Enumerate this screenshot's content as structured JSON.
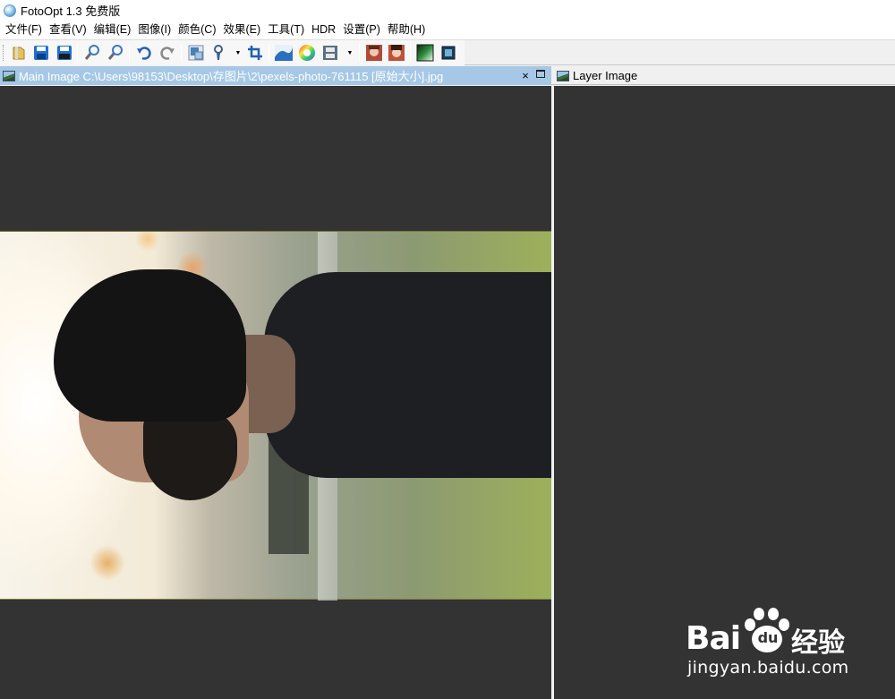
{
  "window": {
    "title": "FotoOpt 1.3 免费版"
  },
  "menu": [
    {
      "label": "文件(F)"
    },
    {
      "label": "查看(V)"
    },
    {
      "label": "编辑(E)"
    },
    {
      "label": "图像(I)"
    },
    {
      "label": "颜色(C)"
    },
    {
      "label": "效果(E)"
    },
    {
      "label": "工具(T)"
    },
    {
      "label": "HDR"
    },
    {
      "label": "设置(P)"
    },
    {
      "label": "帮助(H)"
    }
  ],
  "toolbar": {
    "buttons": [
      {
        "name": "open-file",
        "icon": "folder-icon",
        "color": "#e8c060"
      },
      {
        "name": "save",
        "icon": "floppy-icon",
        "color": "#1f6fd0"
      },
      {
        "name": "save-as",
        "icon": "floppy-stack-icon",
        "color": "#1f6fd0"
      },
      {
        "name": "zoom-in",
        "icon": "zoom-in-icon",
        "color": "#3a78c4"
      },
      {
        "name": "zoom-out",
        "icon": "zoom-out-icon",
        "color": "#3a78c4"
      },
      {
        "name": "undo",
        "icon": "undo-icon",
        "color": "#2a5fb5"
      },
      {
        "name": "redo",
        "icon": "redo-icon",
        "color": "#8a8a8a"
      },
      {
        "name": "resize",
        "icon": "resize-icon",
        "color": "#4a7fb8"
      },
      {
        "name": "brush",
        "icon": "brush-icon",
        "color": "#3d5f8c"
      },
      {
        "name": "crop",
        "icon": "crop-icon",
        "color": "#1f5fb0"
      },
      {
        "name": "levels",
        "icon": "levels-icon",
        "color": "#2b6fc0"
      },
      {
        "name": "color-wheel",
        "icon": "color-wheel-icon",
        "color": "#e04090"
      },
      {
        "name": "filmstrip",
        "icon": "filmstrip-icon",
        "color": "#5a6e86"
      },
      {
        "name": "portrait-1",
        "icon": "portrait-icon",
        "color": "#b04a3a"
      },
      {
        "name": "portrait-2",
        "icon": "portrait-retouch-icon",
        "color": "#c0503a"
      },
      {
        "name": "gradient",
        "icon": "gradient-icon",
        "color": "#2e8b3e"
      },
      {
        "name": "layer-image",
        "icon": "layer-image-icon",
        "color": "#2a5f8a"
      }
    ]
  },
  "main_panel": {
    "title": "Main Image C:\\Users\\98153\\Desktop\\存图片\\2\\pexels-photo-761115 [原始大小].jpg",
    "close_label": "×"
  },
  "layer_panel": {
    "title": "Layer Image"
  },
  "watermark": {
    "brand_left": "Bai",
    "brand_paw": "du",
    "brand_right": "经验",
    "url": "jingyan.baidu.com"
  },
  "colors": {
    "canvas_bg": "#333333",
    "active_tab": "#a6c8e6"
  }
}
